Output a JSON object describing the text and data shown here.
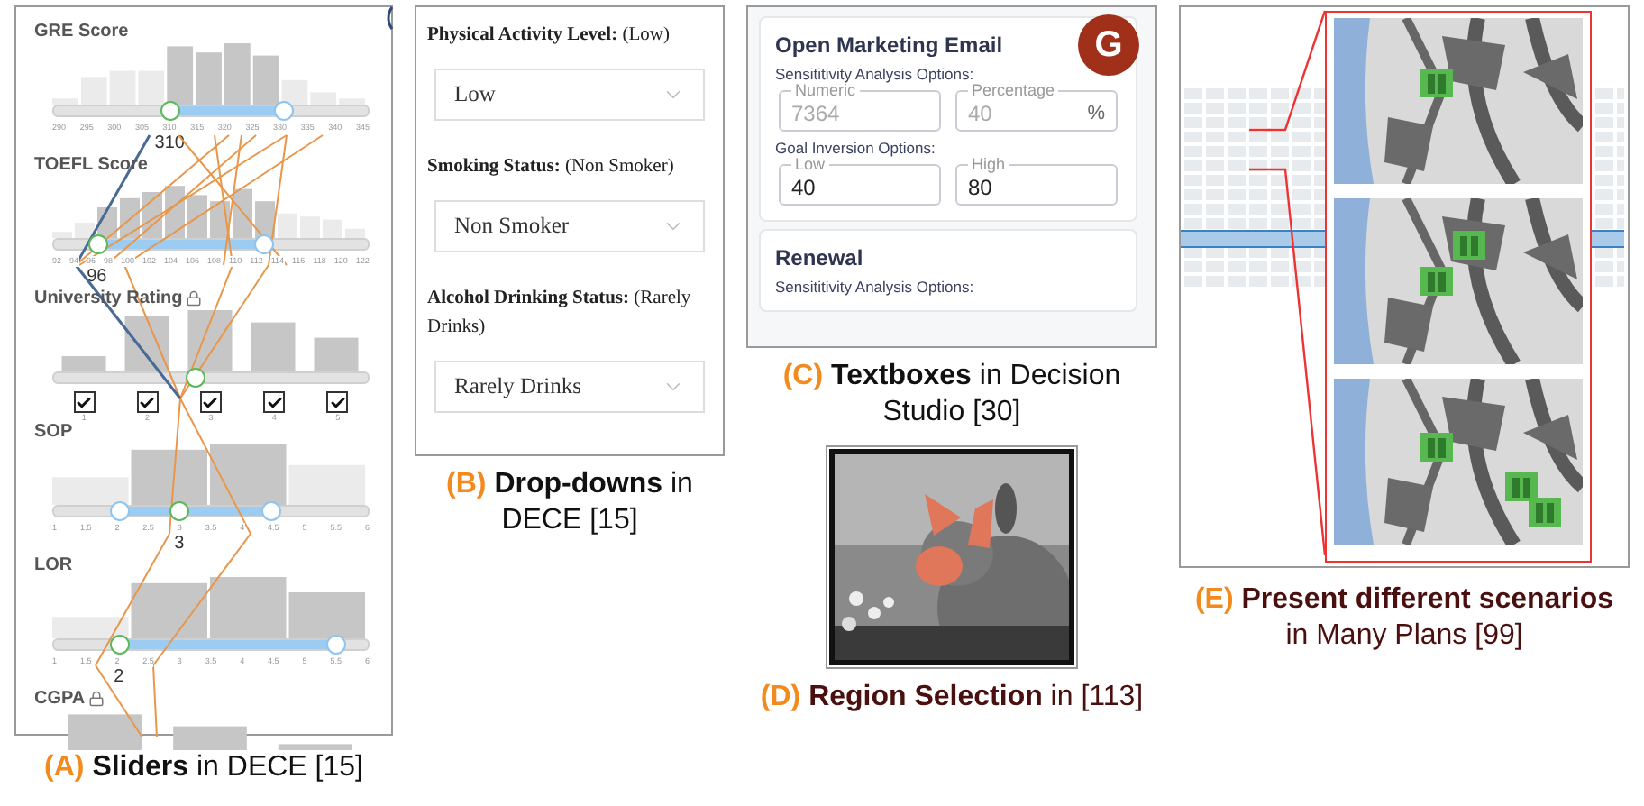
{
  "sliders_panel": {
    "sliders": [
      {
        "kind": "range",
        "label": "GRE Score",
        "locked": false,
        "value": {
          "text": "310",
          "level": 0.37
        },
        "range": {
          "end": {
            "level": 0.73
          }
        },
        "ticks": [
          "290",
          "295",
          "300",
          "305",
          "310",
          "315",
          "320",
          "325",
          "330",
          "335",
          "340",
          "345"
        ]
      },
      {
        "kind": "range",
        "label": "TOEFL Score",
        "locked": false,
        "value": {
          "text": "96",
          "level": 0.14
        },
        "range": {
          "end": {
            "level": 0.67
          }
        },
        "ticks": [
          "92",
          "94",
          "96",
          "98",
          "100",
          "102",
          "104",
          "106",
          "108",
          "110",
          "112",
          "114",
          "116",
          "118",
          "120",
          "122"
        ]
      },
      {
        "kind": "checkboxes",
        "label": "University Rating",
        "locked": true,
        "value": {
          "level": 0.45
        },
        "options": [
          {
            "label": "1",
            "checked": true
          },
          {
            "label": "2",
            "checked": true
          },
          {
            "label": "3",
            "checked": true
          },
          {
            "label": "4",
            "checked": true
          },
          {
            "label": "5",
            "checked": true
          }
        ]
      },
      {
        "kind": "range",
        "label": "SOP",
        "locked": false,
        "value": {
          "text": "3",
          "level": 0.4
        },
        "range": {
          "start": {
            "level": 0.21
          },
          "end": {
            "level": 0.69
          }
        },
        "ticks": [
          "1",
          "1.5",
          "2",
          "2.5",
          "3",
          "3.5",
          "4",
          "4.5",
          "5",
          "5.5",
          "6"
        ]
      },
      {
        "kind": "range",
        "label": "LOR",
        "locked": false,
        "value": {
          "text": "2",
          "level": 0.21
        },
        "range": {
          "end": {
            "level": 0.9
          }
        },
        "ticks": [
          "1",
          "1.5",
          "2",
          "2.5",
          "3",
          "3.5",
          "4",
          "4.5",
          "5",
          "5.5",
          "6"
        ]
      },
      {
        "kind": "cut",
        "label": "CGPA",
        "locked": true
      }
    ],
    "caption": {
      "letter": "(A)",
      "text": "**Sliders** in DECE [15]",
      "kind": "plain"
    }
  },
  "dropdowns_panel": {
    "fields": [
      {
        "label": "**Physical Activity Level:** (Low)",
        "value": "Low"
      },
      {
        "label": "**Smoking Status:** (Non Smoker)",
        "value": "Non Smoker"
      },
      {
        "label": "**Alcohol Drinking Status:** (Rarely Drinks)",
        "value": "Rarely Drinks"
      }
    ],
    "caption": {
      "letter": "(B)",
      "text": "**Drop-downs** in DECE [15]",
      "kind": "plain"
    }
  },
  "textboxes_panel": {
    "cards": [
      {
        "title": "Open Marketing Email",
        "avatar": "G",
        "sections": [
          {
            "label": "Sensititivity Analysis Options:",
            "fields": [
              {
                "label": "Numeric",
                "value": "7364",
                "disabled": true
              },
              {
                "label": "Percentage",
                "value": "40",
                "suffix": "%",
                "disabled": true
              }
            ]
          },
          {
            "label": "Goal Inversion Options:",
            "fields": [
              {
                "label": "Low",
                "value": "40",
                "disabled": false
              },
              {
                "label": "High",
                "value": "80",
                "disabled": false
              }
            ]
          }
        ]
      },
      {
        "title": "Renewal",
        "sections": [
          {
            "label": "Sensititivity Analysis Options:"
          }
        ]
      }
    ],
    "caption": {
      "letter": "(C)",
      "text": "**Textboxes** in Decision Studio [30]",
      "kind": "plain"
    }
  },
  "region_panel": {
    "caption": {
      "letter": "(D)",
      "text": "**Region Selection** in [113]",
      "kind": "maroon"
    }
  },
  "scenarios_panel": {
    "caption": {
      "letter": "(E)",
      "text": "**Present different scenarios** in Many Plans [99]",
      "kind": "maroon"
    }
  }
}
